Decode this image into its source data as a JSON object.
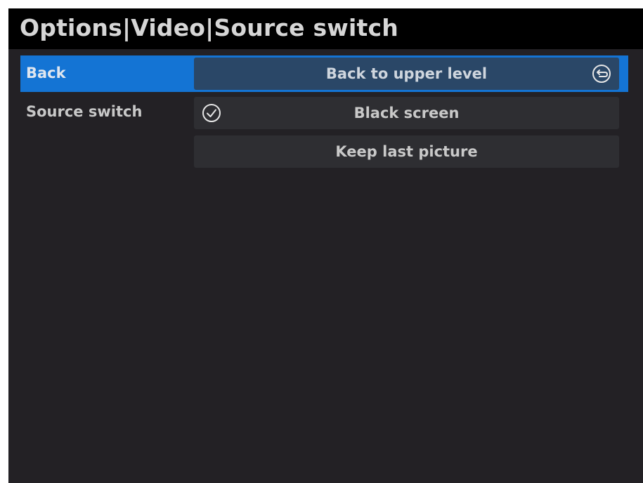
{
  "title": "Options|Video|Source switch",
  "menu": {
    "back_label": "Back",
    "back_option": "Back to upper level",
    "source_label": "Source switch",
    "options": [
      {
        "label": "Black screen",
        "selected": true
      },
      {
        "label": "Keep last picture",
        "selected": false
      }
    ]
  },
  "icons": {
    "back": "back-arrow-circle-icon",
    "selected": "checkmark-circle-icon"
  },
  "colors": {
    "highlight": "#1474d4",
    "background": "#232125",
    "title_bar": "#000000"
  }
}
